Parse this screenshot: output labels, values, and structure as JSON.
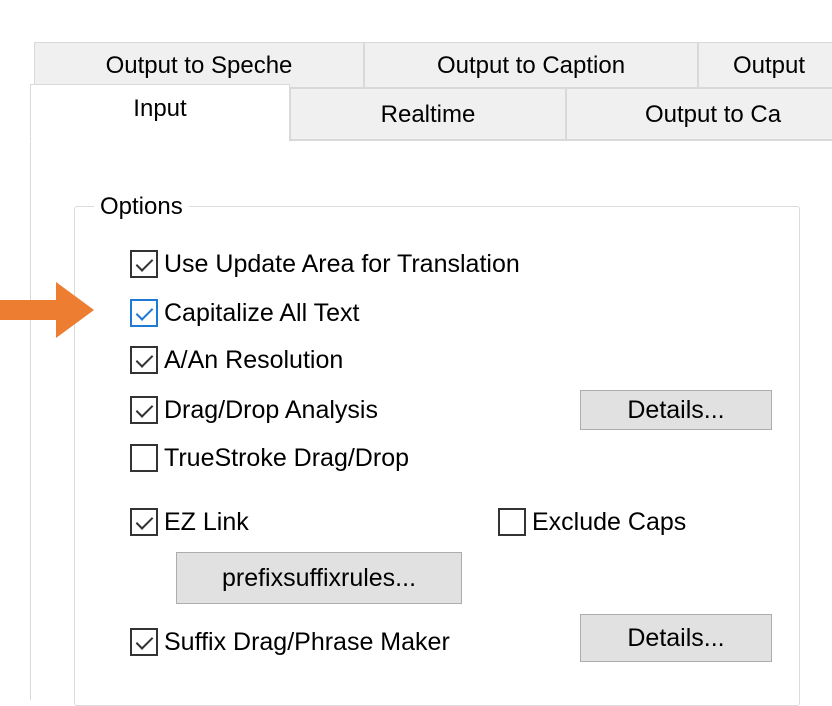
{
  "tabs": {
    "row1": [
      {
        "label": "Output to Speche"
      },
      {
        "label": "Output to Caption"
      },
      {
        "label": "Output"
      }
    ],
    "row2": [
      {
        "label": "Input"
      },
      {
        "label": "Realtime"
      },
      {
        "label": "Output to Ca"
      }
    ]
  },
  "options": {
    "legend": "Options",
    "use_update_area": "Use Update Area for Translation",
    "capitalize_all_text": "Capitalize All Text",
    "a_an_resolution": "A/An Resolution",
    "drag_drop_analysis": "Drag/Drop Analysis",
    "details_1": "Details...",
    "truestroke_drag_drop": "TrueStroke Drag/Drop",
    "ez_link": "EZ Link",
    "exclude_caps": "Exclude Caps",
    "prefix_suffix_rules": "prefixsuffixrules...",
    "suffix_drag_phrase_maker": "Suffix Drag/Phrase Maker",
    "details_2": "Details..."
  },
  "checked": {
    "use_update_area": true,
    "capitalize_all_text": true,
    "a_an_resolution": true,
    "drag_drop_analysis": true,
    "truestroke_drag_drop": false,
    "ez_link": true,
    "exclude_caps": false,
    "suffix_drag_phrase_maker": true
  },
  "colors": {
    "arrow": "#ed7d31",
    "focus_checkbox": "#1e7ad6"
  },
  "icons": {
    "arrow": "arrow-right-icon"
  }
}
